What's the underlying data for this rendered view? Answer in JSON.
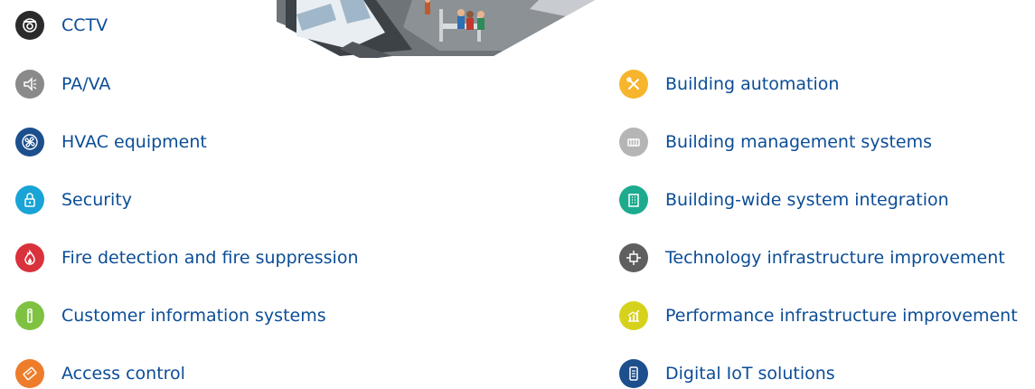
{
  "left_items": [
    {
      "label": "CCTV",
      "icon": "cctv-camera-icon",
      "color": "#2b2b2b"
    },
    {
      "label": "PA/VA",
      "icon": "speaker-icon",
      "color": "#8a8a8a"
    },
    {
      "label": "HVAC equipment",
      "icon": "fan-icon",
      "color": "#1c4f8c"
    },
    {
      "label": "Security",
      "icon": "lock-icon",
      "color": "#1aa3d6"
    },
    {
      "label": "Fire detection and fire suppression",
      "icon": "flame-icon",
      "color": "#d9323c"
    },
    {
      "label": "Customer information systems",
      "icon": "info-icon",
      "color": "#7fc241"
    },
    {
      "label": "Access control",
      "icon": "keycard-icon",
      "color": "#ee7d2b"
    }
  ],
  "right_items": [
    {
      "label": "Building automation",
      "icon": "tools-icon",
      "color": "#f6b52c"
    },
    {
      "label": "Building management systems",
      "icon": "building-icon",
      "color": "#b5b5b5"
    },
    {
      "label": "Building-wide system integration",
      "icon": "office-building-icon",
      "color": "#1dab8f"
    },
    {
      "label": "Technology infrastructure improvement",
      "icon": "chip-icon",
      "color": "#5f5f5f"
    },
    {
      "label": "Performance infrastructure improvement",
      "icon": "performance-chart-icon",
      "color": "#d6d21c"
    },
    {
      "label": "Digital IoT solutions",
      "icon": "device-icon",
      "color": "#1c4f8c"
    }
  ]
}
